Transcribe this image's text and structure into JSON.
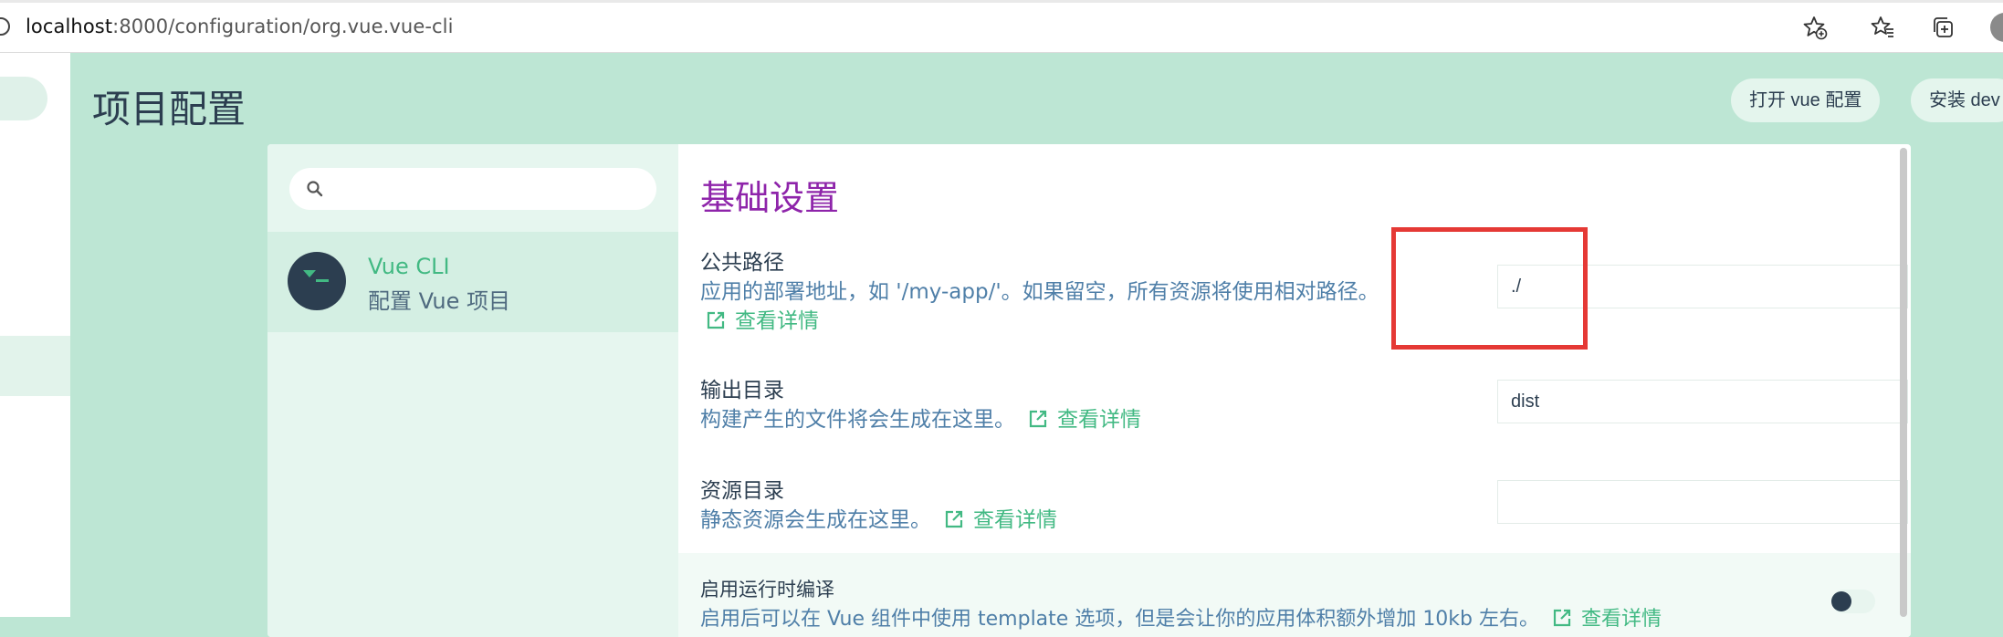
{
  "browser": {
    "url_host": "localhost",
    "url_rest": ":8000/configuration/org.vue.vue-cli"
  },
  "page": {
    "title": "项目配置",
    "open_config_button": "打开 vue 配置",
    "install_button": "安装 dev"
  },
  "sidebar": {
    "search_placeholder": "",
    "plugin": {
      "name": "Vue CLI",
      "description": "配置 Vue 项目"
    }
  },
  "section": {
    "title": "基础设置",
    "more_label": "查看详情",
    "fields": [
      {
        "label": "公共路径",
        "description": "应用的部署地址，如 '/my-app/'。如果留空，所有资源将使用相对路径。",
        "value": "./"
      },
      {
        "label": "输出目录",
        "description": "构建产生的文件将会生成在这里。",
        "value": "dist"
      },
      {
        "label": "资源目录",
        "description": "静态资源会生成在这里。",
        "value": ""
      },
      {
        "label": "启用运行时编译",
        "description": "启用后可以在 Vue 组件中使用 template 选项，但是会让你的应用体积额外增加 10kb 左右。",
        "enabled": false
      }
    ]
  },
  "colors": {
    "accent": "#42b983",
    "section_title": "#8e24aa",
    "highlight": "#e53935",
    "background": "#bde6d4"
  }
}
